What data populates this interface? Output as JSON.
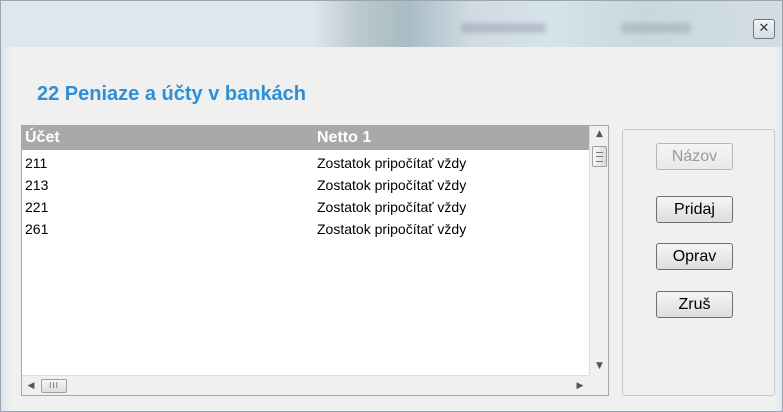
{
  "window": {
    "close_symbol": "✕",
    "close_icon": "close-icon"
  },
  "header": {
    "title": "22 Peniaze a účty v bankách",
    "title_color": "#2e8fd6"
  },
  "table": {
    "columns": [
      "Účet",
      "Netto 1"
    ],
    "rows": [
      {
        "account": "211",
        "netto": "Zostatok pripočítať vždy"
      },
      {
        "account": "213",
        "netto": "Zostatok pripočítať vždy"
      },
      {
        "account": "221",
        "netto": "Zostatok pripočítať vždy"
      },
      {
        "account": "261",
        "netto": "Zostatok pripočítať vždy"
      }
    ],
    "header_color": "#a9a9a9"
  },
  "scroll": {
    "up_symbol": "▲",
    "down_symbol": "▼",
    "left_symbol": "◀",
    "right_symbol": "▶",
    "grip_symbol": "III"
  },
  "buttons": {
    "name": "Názov",
    "add": "Pridaj",
    "edit": "Oprav",
    "delete": "Zruš"
  }
}
